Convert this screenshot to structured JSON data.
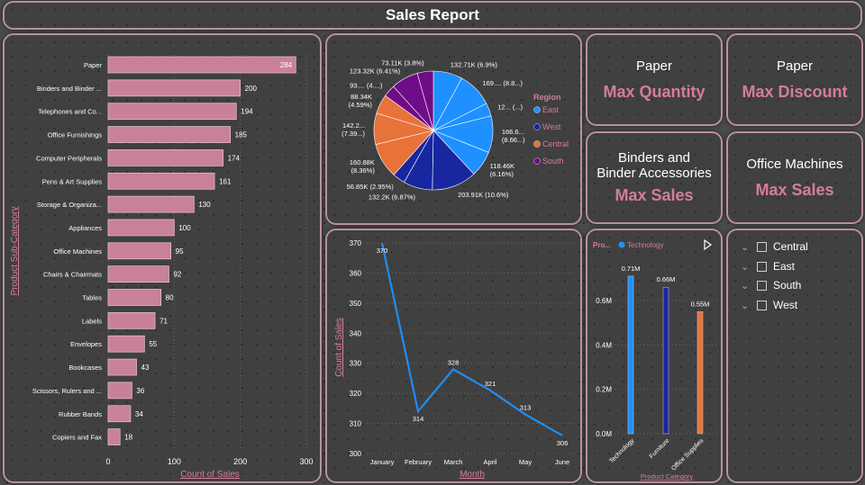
{
  "page_title": "Sales Report",
  "colors": {
    "bar_pink": "#c98197",
    "accent_pink": "#d67d97",
    "line_blue": "#1f8ef1",
    "pie_east": "#1e90ff",
    "pie_west": "#1826a0",
    "pie_central": "#e8733a",
    "pie_south": "#6e0d87"
  },
  "kpis": [
    {
      "title": "Paper",
      "value": "Max Quantity"
    },
    {
      "title": "Paper",
      "value": "Max Discount"
    },
    {
      "title": "Binders and\nBinder Accessories",
      "value": "Max Sales"
    },
    {
      "title": "Office Machines",
      "value": "Max Sales"
    }
  ],
  "slicer": {
    "items": [
      "Central",
      "East",
      "South",
      "West"
    ]
  },
  "chart_data": [
    {
      "type": "bar",
      "orientation": "horizontal",
      "ylabel": "Product Sub-Category",
      "xlabel": "Count of Sales",
      "xlim": [
        0,
        300
      ],
      "xticks": [
        "0",
        "100",
        "200",
        "300"
      ],
      "categories": [
        "Paper",
        "Binders and Binder ...",
        "Telephones and Co...",
        "Office Furnishings",
        "Computer Peripherals",
        "Pens & Art Supplies",
        "Storage & Organiza...",
        "Appliances",
        "Office Machines",
        "Chairs & Chairmats",
        "Tables",
        "Labels",
        "Envelopes",
        "Bookcases",
        "Scissors, Rulers and ...",
        "Rubber Bands",
        "Copiers and Fax"
      ],
      "values": [
        284,
        200,
        194,
        185,
        174,
        161,
        130,
        100,
        95,
        92,
        80,
        71,
        55,
        43,
        36,
        34,
        18
      ],
      "grid": true
    },
    {
      "type": "pie",
      "legend_title": "Region",
      "legend": [
        "East",
        "West",
        "Central",
        "South"
      ],
      "legend_placement": "right",
      "slices": [
        {
          "region": "East",
          "value": 132.71,
          "label": "132.71K (6.9%)"
        },
        {
          "region": "East",
          "value": 160,
          "label": "169.... (8.8...)"
        },
        {
          "region": "East",
          "value": 60,
          "label": "12... (...)"
        },
        {
          "region": "East",
          "value": 166.6,
          "label": "166.6...\n(8.66...)"
        },
        {
          "region": "East",
          "value": 118.46,
          "label": "118.46K\n(6.16%)"
        },
        {
          "region": "West",
          "value": 203.91,
          "label": "203.91K (10.6%)"
        },
        {
          "region": "West",
          "value": 132.2,
          "label": "132.2K (6.87%)"
        },
        {
          "region": "West",
          "value": 56.85,
          "label": "56.85K (2.95%)"
        },
        {
          "region": "Central",
          "value": 160.88,
          "label": "160.88K\n(8.36%)"
        },
        {
          "region": "Central",
          "value": 142.2,
          "label": "142.2...\n(7.39...)"
        },
        {
          "region": "Central",
          "value": 88.34,
          "label": "88.34K\n(4.59%)"
        },
        {
          "region": "South",
          "value": 55,
          "label": "93.... (4....)"
        },
        {
          "region": "South",
          "value": 123.32,
          "label": "123.32K (6.41%)"
        },
        {
          "region": "South",
          "value": 73.11,
          "label": "73.11K (3.8%)"
        }
      ]
    },
    {
      "type": "line",
      "xlabel": "Month",
      "ylabel": "Count of Sales",
      "categories": [
        "January",
        "February",
        "March",
        "April",
        "May",
        "June"
      ],
      "values": [
        370,
        314,
        328,
        321,
        313,
        306
      ],
      "ylim": [
        300,
        370
      ],
      "yticks": [
        300,
        310,
        320,
        330,
        340,
        350,
        360,
        370
      ],
      "grid": true
    },
    {
      "type": "bar",
      "legend_title": "Pro...",
      "legend": [
        "Technology"
      ],
      "xlabel": "Product Category",
      "categories": [
        "Technology",
        "Furniture",
        "Office Supplies"
      ],
      "values": [
        0.71,
        0.66,
        0.55
      ],
      "value_labels": [
        "0.71M",
        "0.66M",
        "0.55M"
      ],
      "colors": [
        "#1e90ff",
        "#1826a0",
        "#e8733a"
      ],
      "ylim": [
        0,
        0.8
      ],
      "yticks": [
        "0.0M",
        "0.2M",
        "0.4M",
        "0.6M"
      ],
      "grid": true
    }
  ]
}
